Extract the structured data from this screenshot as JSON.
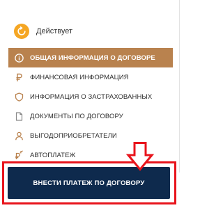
{
  "status": {
    "label": "Действует",
    "icon": "refresh-icon",
    "color": "#f5a623"
  },
  "menu": {
    "items": [
      {
        "label": "ОБЩАЯ ИНФОРМАЦИЯ О ДОГОВОРЕ",
        "icon": "info-icon",
        "active": true
      },
      {
        "label": "ФИНАНСОВАЯ ИНФОРМАЦИЯ",
        "icon": "ruble-icon",
        "active": false
      },
      {
        "label": "ИНФОРМАЦИЯ О ЗАСТРАХОВАННЫХ",
        "icon": "shield-icon",
        "active": false
      },
      {
        "label": "ДОКУМЕНТЫ ПО ДОГОВОРУ",
        "icon": "document-icon",
        "active": false
      },
      {
        "label": "ВЫГОДОПРИОБРЕТАТЕЛИ",
        "icon": "person-icon",
        "active": false
      },
      {
        "label": "АВТОПЛАТЕЖ",
        "icon": "ruble-autopay-icon",
        "active": false
      }
    ]
  },
  "pay_button": {
    "label": "ВНЕСТИ ПЛАТЕЖ ПО ДОГОВОРУ"
  },
  "colors": {
    "active_bg": "#b9824e",
    "button_bg": "#0e2a4d",
    "highlight": "#e8141c"
  }
}
